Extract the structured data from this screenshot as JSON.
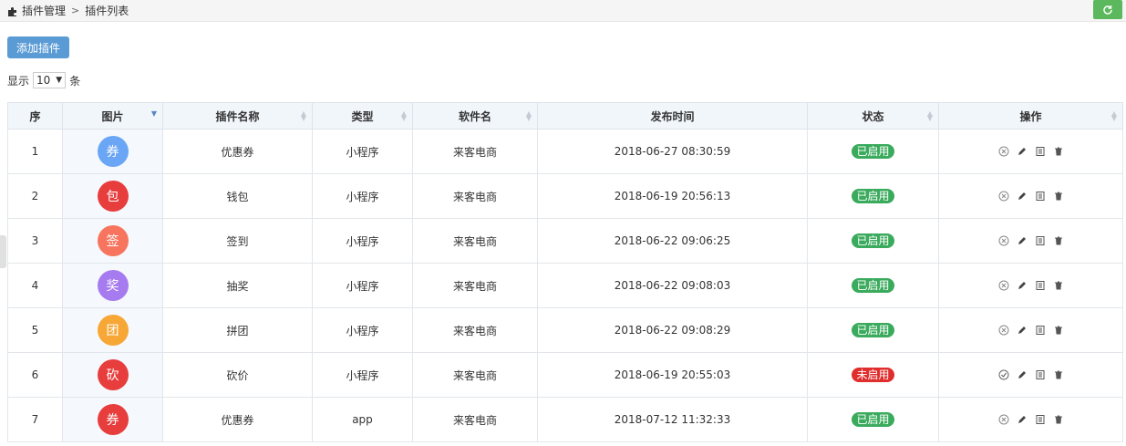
{
  "breadcrumb": {
    "first": "插件管理",
    "separator": ">",
    "second": "插件列表"
  },
  "toolbar": {
    "add_label": "添加插件"
  },
  "pager": {
    "show_label": "显示",
    "page_size": "10",
    "unit_label": "条"
  },
  "table": {
    "headers": [
      "序",
      "图片",
      "插件名称",
      "类型",
      "软件名",
      "发布时间",
      "状态",
      "操作"
    ],
    "rows": [
      {
        "idx": "1",
        "icon_char": "券",
        "icon_color": "#6aa6f5",
        "name": "优惠券",
        "type": "小程序",
        "software": "来客电商",
        "time": "2018-06-27 08:30:59",
        "status": "已启用",
        "status_color": "#3aaa5c"
      },
      {
        "idx": "2",
        "icon_char": "包",
        "icon_color": "#e83d3d",
        "name": "钱包",
        "type": "小程序",
        "software": "来客电商",
        "time": "2018-06-19 20:56:13",
        "status": "已启用",
        "status_color": "#3aaa5c"
      },
      {
        "idx": "3",
        "icon_char": "签",
        "icon_color": "#f7755f",
        "name": "签到",
        "type": "小程序",
        "software": "来客电商",
        "time": "2018-06-22 09:06:25",
        "status": "已启用",
        "status_color": "#3aaa5c"
      },
      {
        "idx": "4",
        "icon_char": "奖",
        "icon_color": "#a77bf0",
        "name": "抽奖",
        "type": "小程序",
        "software": "来客电商",
        "time": "2018-06-22 09:08:03",
        "status": "已启用",
        "status_color": "#3aaa5c"
      },
      {
        "idx": "5",
        "icon_char": "团",
        "icon_color": "#f7a736",
        "name": "拼团",
        "type": "小程序",
        "software": "来客电商",
        "time": "2018-06-22 09:08:29",
        "status": "已启用",
        "status_color": "#3aaa5c"
      },
      {
        "idx": "6",
        "icon_char": "砍",
        "icon_color": "#e83d3d",
        "name": "砍价",
        "type": "小程序",
        "software": "来客电商",
        "time": "2018-06-19 20:55:03",
        "status": "未启用",
        "status_color": "#e02d2d"
      },
      {
        "idx": "7",
        "icon_char": "券",
        "icon_color": "#e83d3d",
        "name": "优惠券",
        "type": "app",
        "software": "来客电商",
        "time": "2018-07-12 11:32:33",
        "status": "已启用",
        "status_color": "#3aaa5c"
      }
    ]
  },
  "colors": {
    "primary": "#5b9bd5",
    "refresh": "#5cb85c",
    "enabled": "#3aaa5c",
    "disabled": "#e02d2d"
  }
}
